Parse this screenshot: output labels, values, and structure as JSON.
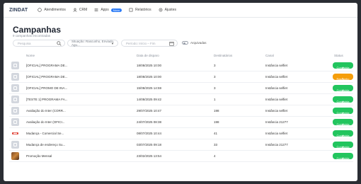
{
  "nav": {
    "logo_prefix": "ZINDAT",
    "logo_suffix": "",
    "items": [
      {
        "label": "Atendimentos",
        "icon": "chat-icon"
      },
      {
        "label": "CRM",
        "icon": "users-icon"
      },
      {
        "label": "Apps",
        "icon": "grid-icon",
        "badge": "Novo"
      },
      {
        "label": "Relatórios",
        "icon": "report-icon"
      },
      {
        "label": "Ajustes",
        "icon": "gear-icon"
      }
    ]
  },
  "page": {
    "title": "Campanhas",
    "subtitle": "9 campanhas encontradas"
  },
  "filters": {
    "search_placeholder": "Pesquisa",
    "situation_label": "Situação: Rascunho, Enviado, Agu...",
    "period_placeholder": "Período: Início – Fim",
    "archived_label": "Arquivadas"
  },
  "table": {
    "columns": [
      "Nome",
      "Data de disparo",
      "Destinatários",
      "Canal",
      "Status"
    ],
    "rows": [
      {
        "name": "[OFICIAL] PROGRAMA DE...",
        "date": "18/08/2025 10:00",
        "recipients": "3",
        "channel": "Instância selfiet",
        "status": "Concluída",
        "status_kind": "ok",
        "thumb": "doc"
      },
      {
        "name": "[OFICIAL] PROGRAMA DE...",
        "date": "18/08/2025 10:00",
        "recipients": "3",
        "channel": "Instância selfiet",
        "status": "Rascunho",
        "status_kind": "wait",
        "thumb": "doc"
      },
      {
        "name": "[OFICIAL] PROMO DE INA...",
        "date": "15/08/2025 14:59",
        "recipients": "3",
        "channel": "Instância selfiet",
        "status": "Concluída",
        "status_kind": "ok",
        "thumb": "doc"
      },
      {
        "name": "[TESTE 1] PROGRAMA FA...",
        "date": "14/08/2025 09:42",
        "recipients": "1",
        "channel": "Instância selfiet",
        "status": "Concluída",
        "status_kind": "ok",
        "thumb": "doc"
      },
      {
        "name": "Avaliação do Inter (CORR...",
        "date": "29/07/2025 10:47",
        "recipients": "198",
        "channel": "Instância selfiet",
        "status": "Concluída",
        "status_kind": "ok",
        "thumb": "doc"
      },
      {
        "name": "Avaliação do Inter (OFICI...",
        "date": "24/07/2025 08:38",
        "recipients": "198",
        "channel": "Instância 21277",
        "status": "Concluída",
        "status_kind": "ok",
        "thumb": "doc"
      },
      {
        "name": "Mudança - Comercial Se...",
        "date": "08/07/2025 10:44",
        "recipients": "41",
        "channel": "Instância selfiet",
        "status": "Concluída",
        "status_kind": "ok",
        "thumb": "img1"
      },
      {
        "name": "Mudança de endereço Su...",
        "date": "03/07/2025 09:18",
        "recipients": "33",
        "channel": "Instância 21277",
        "status": "Concluída",
        "status_kind": "ok",
        "thumb": "doc"
      },
      {
        "name": "Promoção Mensal",
        "date": "23/02/2025 13:54",
        "recipients": "4",
        "channel": "",
        "status": "Concluída",
        "status_kind": "ok",
        "thumb": "img2"
      }
    ]
  },
  "colors": {
    "ok": "#22c55e",
    "wait": "#f59e0b",
    "accent": "#2e7cf6"
  }
}
